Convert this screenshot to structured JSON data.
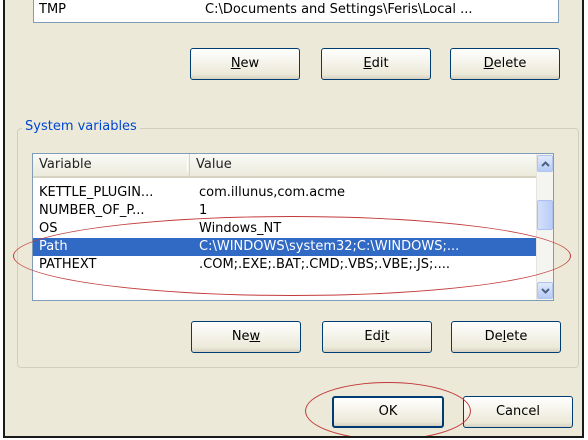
{
  "user_variables": {
    "partial_row": {
      "variable": "TMP",
      "value": "C:\\Documents and Settings\\Feris\\Local ..."
    },
    "buttons": {
      "new": {
        "pre": "",
        "acc": "N",
        "post": "ew"
      },
      "edit": {
        "pre": "",
        "acc": "E",
        "post": "dit"
      },
      "delete": {
        "pre": "",
        "acc": "D",
        "post": "elete"
      }
    }
  },
  "system_variables": {
    "title": "System variables",
    "columns": {
      "variable": "Variable",
      "value": "Value"
    },
    "rows": [
      {
        "variable": "KETTLE_PLUGIN...",
        "value": "com.illunus,com.acme"
      },
      {
        "variable": "NUMBER_OF_P...",
        "value": "1"
      },
      {
        "variable": "OS",
        "value": "Windows_NT"
      },
      {
        "variable": "Path",
        "value": "C:\\WINDOWS\\system32;C:\\WINDOWS;..."
      },
      {
        "variable": "PATHEXT",
        "value": ".COM;.EXE;.BAT;.CMD;.VBS;.VBE;.JS;...."
      }
    ],
    "selected_row": "Path",
    "buttons": {
      "new": {
        "pre": "Ne",
        "acc": "w",
        "post": ""
      },
      "edit": {
        "pre": "Ed",
        "acc": "i",
        "post": "t"
      },
      "delete": {
        "pre": "De",
        "acc": "l",
        "post": "ete"
      }
    }
  },
  "dialog_buttons": {
    "ok": "OK",
    "cancel": "Cancel"
  },
  "colors": {
    "dialog_bg": "#ece9d8",
    "selection": "#316ac5",
    "groupbox_title": "#0046d5",
    "annotation": "#c23a3a"
  },
  "icons": {
    "scroll_up": "chevron-up-icon",
    "scroll_down": "chevron-down-icon"
  }
}
